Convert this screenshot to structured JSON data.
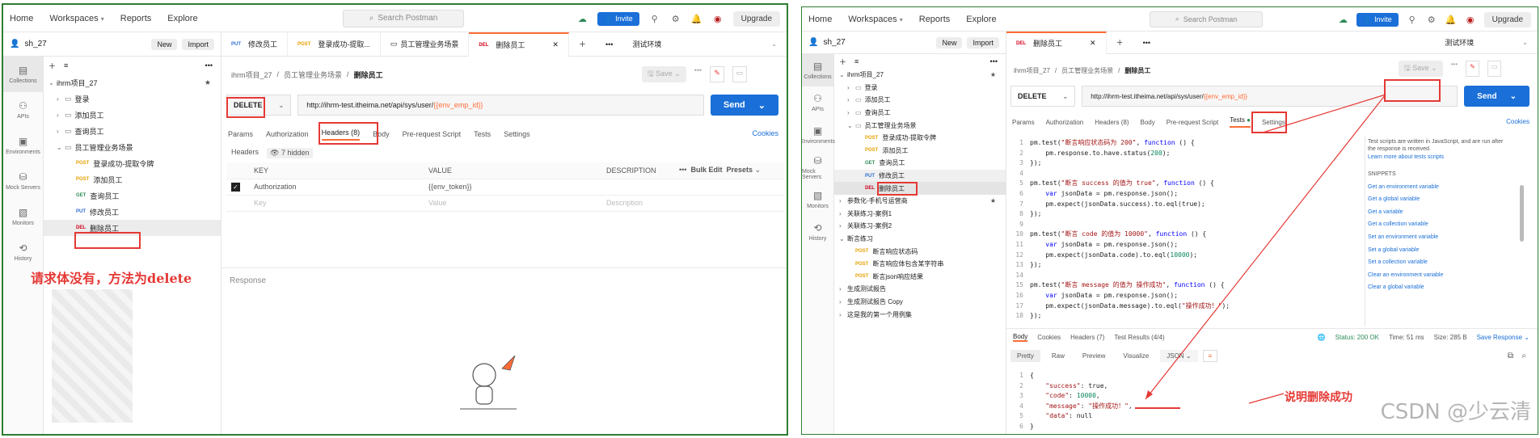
{
  "nav": {
    "home": "Home",
    "workspaces": "Workspaces",
    "reports": "Reports",
    "explore": "Explore",
    "search": "Search Postman",
    "invite": "Invite",
    "upgrade": "Upgrade"
  },
  "ws": {
    "name": "sh_27",
    "new": "New",
    "import": "Import"
  },
  "rail": [
    "Collections",
    "APIs",
    "Environments",
    "Mock Servers",
    "Monitors",
    "History"
  ],
  "left": {
    "tabs": [
      {
        "m": "PUT",
        "t": "修改员工"
      },
      {
        "m": "POST",
        "t": "登录成功-提取..."
      },
      {
        "m": "",
        "t": "员工管理业务场景"
      },
      {
        "m": "DEL",
        "t": "删除员工"
      }
    ],
    "env": "测试环境",
    "tree": [
      {
        "t": "ihrm项目_27"
      },
      {
        "t": "登录"
      },
      {
        "t": "添加员工"
      },
      {
        "t": "查询员工"
      },
      {
        "t": "员工管理业务场景"
      },
      {
        "m": "POST",
        "t": "登录成功-提取令牌"
      },
      {
        "m": "POST",
        "t": "添加员工"
      },
      {
        "m": "GET",
        "t": "查询员工"
      },
      {
        "m": "PUT",
        "t": "修改员工"
      },
      {
        "m": "DEL",
        "t": "删除员工"
      }
    ],
    "crumb": [
      "ihrm项目_27",
      "员工管理业务场景",
      "删除员工"
    ],
    "save": "Save",
    "method": "DELETE",
    "url_base": "http://ihrm-test.itheima.net/api/sys/user/",
    "url_var": "{{env_emp_id}}",
    "send": "Send",
    "rtabs": [
      "Params",
      "Authorization",
      "Headers (8)",
      "Body",
      "Pre-request Script",
      "Tests",
      "Settings"
    ],
    "cookies": "Cookies",
    "headers_label": "Headers",
    "hidden": "7 hidden",
    "cols": [
      "KEY",
      "VALUE",
      "DESCRIPTION",
      "Bulk Edit",
      "Presets"
    ],
    "row": {
      "key": "Authorization",
      "value": "{{env_token}}"
    },
    "ph": {
      "key": "Key",
      "value": "Value",
      "desc": "Description"
    },
    "response": "Response",
    "note": "请求体没有，方法为delete"
  },
  "right": {
    "tab": "删除员工",
    "env": "测试环境",
    "tree": [
      {
        "t": "ihrm项目_27"
      },
      {
        "t": "登录"
      },
      {
        "t": "添加员工"
      },
      {
        "t": "查询员工"
      },
      {
        "t": "员工管理业务场景"
      },
      {
        "m": "POST",
        "t": "登录成功-提取令牌"
      },
      {
        "m": "POST",
        "t": "添加员工"
      },
      {
        "m": "GET",
        "t": "查询员工"
      },
      {
        "m": "PUT",
        "t": "修改员工"
      },
      {
        "m": "DEL",
        "t": "删除员工"
      },
      {
        "t": "参数化-手机号运营商"
      },
      {
        "t": "关联练习-案例1"
      },
      {
        "t": "关联练习-案例2"
      },
      {
        "t": "断言练习"
      },
      {
        "m": "POST",
        "t": "断言响应状态码"
      },
      {
        "m": "POST",
        "t": "断言响应体包含某字符串"
      },
      {
        "m": "POST",
        "t": "断言json响应结果"
      },
      {
        "t": "生成测试报告"
      },
      {
        "t": "生成测试报告 Copy"
      },
      {
        "t": "这是我的第一个用例集"
      }
    ],
    "rtabs": [
      "Params",
      "Authorization",
      "Headers (8)",
      "Body",
      "Pre-request Script",
      "Tests",
      "Settings"
    ],
    "code": [
      "pm.test(\"断言响应状态码为 200\", function () {",
      "    pm.response.to.have.status(200);",
      "});",
      "",
      "pm.test(\"断言 success 的值为 true\", function () {",
      "    var jsonData = pm.response.json();",
      "    pm.expect(jsonData.success).to.eql(true);",
      "});",
      "",
      "pm.test(\"断言 code 的值为 10000\", function () {",
      "    var jsonData = pm.response.json();",
      "    pm.expect(jsonData.code).to.eql(10000);",
      "});",
      "",
      "pm.test(\"断言 message 的值为 操作成功\", function () {",
      "    var jsonData = pm.response.json();",
      "    pm.expect(jsonData.message).to.eql(\"操作成功！\");",
      "});"
    ],
    "side": {
      "intro": "Test scripts are written in JavaScript, and are run after the response is received.",
      "learn": "Learn more about tests scripts",
      "snip": "SNIPPETS",
      "items": [
        "Get an environment variable",
        "Get a global variable",
        "Get a variable",
        "Get a collection variable",
        "Set an environment variable",
        "Set a global variable",
        "Set a collection variable",
        "Clear an environment variable",
        "Clear a global variable"
      ]
    },
    "resp_tabs": [
      "Body",
      "Cookies",
      "Headers (7)",
      "Test Results (4/4)"
    ],
    "status": "Status: 200 OK",
    "time": "Time: 51 ms",
    "size": "Size: 285 B",
    "save_resp": "Save Response",
    "views": [
      "Pretty",
      "Raw",
      "Preview",
      "Visualize",
      "JSON"
    ],
    "json": [
      "{",
      "    \"success\": true,",
      "    \"code\": 10000,",
      "    \"message\": \"操作成功！\",",
      "    \"data\": null",
      "}"
    ],
    "note": "说明删除成功",
    "watermark": "CSDN @少云清"
  }
}
